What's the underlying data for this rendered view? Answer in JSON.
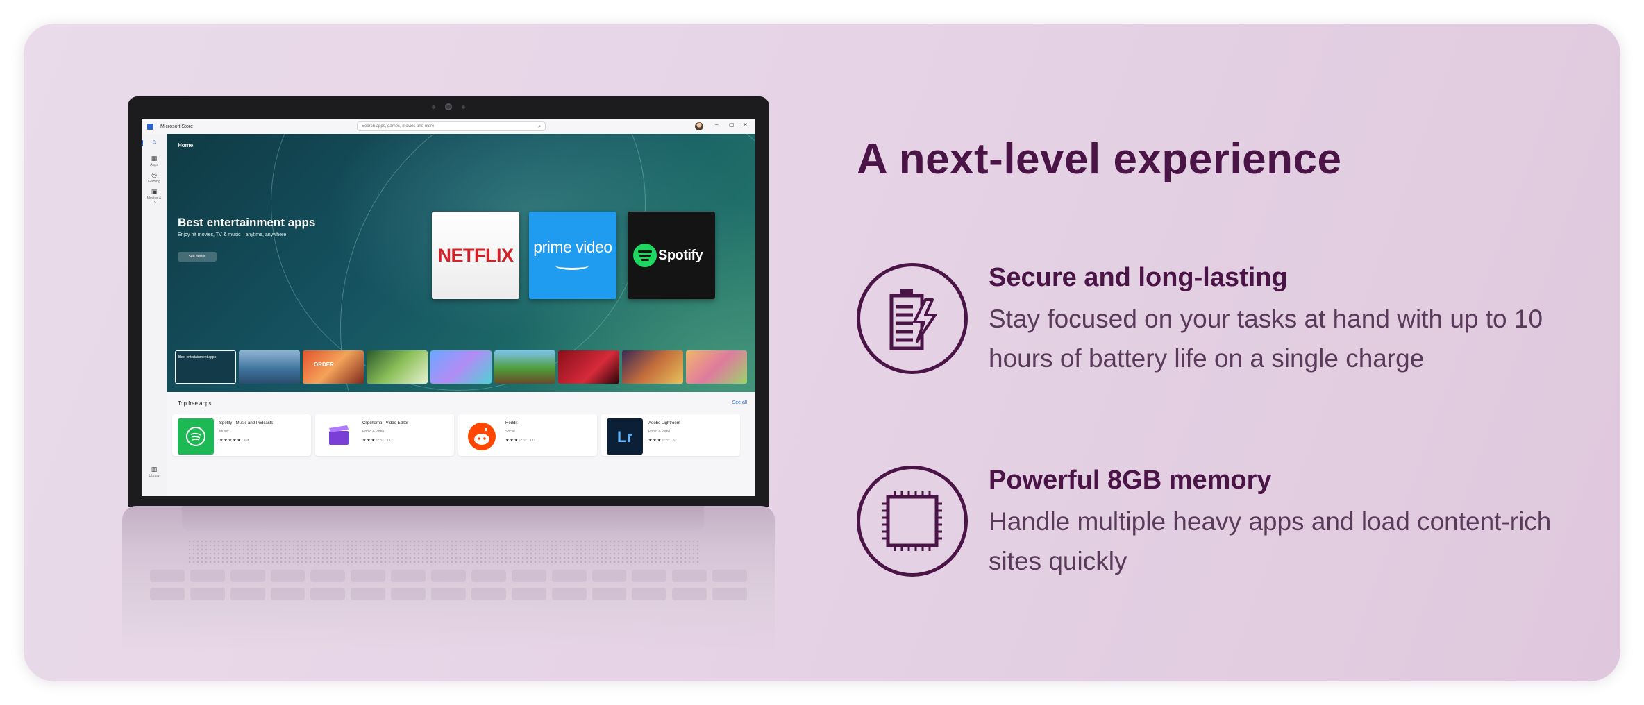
{
  "headline": "A next-level experience",
  "features": [
    {
      "title": "Secure and long-lasting",
      "description": "Stay focused on your tasks at hand with up to 10 hours of battery life on a single charge",
      "icon": "battery-charging-icon"
    },
    {
      "title": "Powerful 8GB memory",
      "description": "Handle multiple heavy apps and load content-rich sites quickly",
      "icon": "memory-chip-icon"
    }
  ],
  "store": {
    "window_title": "Microsoft Store",
    "search_placeholder": "Search apps, games, movies and more",
    "nav": [
      {
        "label": "",
        "icon": "home-icon"
      },
      {
        "label": "Apps",
        "icon": "apps-icon"
      },
      {
        "label": "Gaming",
        "icon": "gaming-icon"
      },
      {
        "label": "Movies & TV",
        "icon": "movies-icon"
      },
      {
        "label": "Library",
        "icon": "library-icon"
      }
    ],
    "hero": {
      "page_label": "Home",
      "title": "Best entertainment apps",
      "subtitle": "Enjoy hit movies, TV & music—anytime, anywhere",
      "button": "See details",
      "tiles": [
        "NETFLIX",
        "prime video",
        "Spotify"
      ]
    },
    "carousel": [
      {
        "label": "Best entertainment apps"
      },
      {
        "label": ""
      },
      {
        "label": "ORDER"
      },
      {
        "label": ""
      },
      {
        "label": ""
      },
      {
        "label": ""
      },
      {
        "label": ""
      },
      {
        "label": ""
      },
      {
        "label": ""
      }
    ],
    "section_title": "Top free apps",
    "see_all": "See all",
    "apps": [
      {
        "name": "Spotify - Music and Podcasts",
        "category": "Music",
        "stars": "★★★★★",
        "count": "10K",
        "color": "#1db954",
        "icon": "spotify-icon"
      },
      {
        "name": "Clipchamp - Video Editor",
        "category": "Photo & video",
        "stars": "★★★☆☆",
        "count": "1K",
        "color": "#7a3fd6",
        "icon": "clipchamp-icon"
      },
      {
        "name": "Reddit",
        "category": "Social",
        "stars": "★★★☆☆",
        "count": "133",
        "color": "#ff4500",
        "icon": "reddit-icon"
      },
      {
        "name": "Adobe Lightroom",
        "category": "Photo & video",
        "stars": "★★★☆☆",
        "count": "31",
        "color": "#0b1f36",
        "icon": "lightroom-icon"
      }
    ]
  }
}
